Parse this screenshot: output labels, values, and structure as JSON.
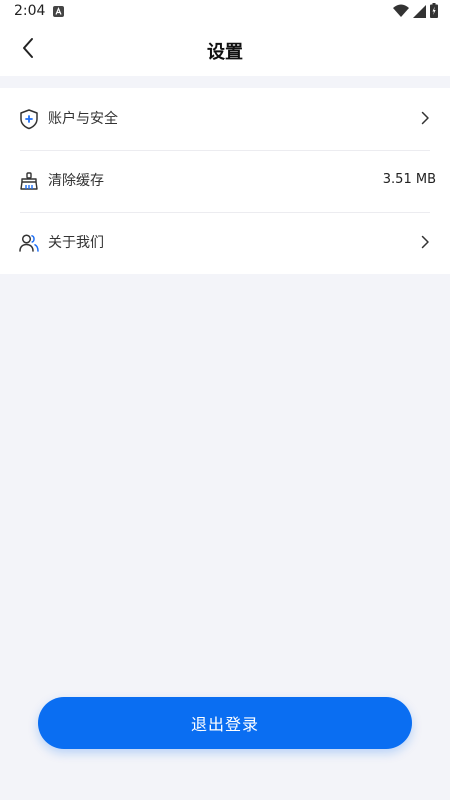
{
  "status_bar": {
    "time": "2:04",
    "icons": [
      "app-notification-icon",
      "wifi-icon",
      "signal-icon",
      "battery-charging-icon"
    ]
  },
  "header": {
    "title": "设置",
    "back_icon": "chevron-left-icon"
  },
  "menu": {
    "items": [
      {
        "label": "账户与安全",
        "icon": "shield-plus-icon",
        "trailing": "chevron-right-icon"
      },
      {
        "label": "清除缓存",
        "icon": "broom-icon",
        "value": "3.51 MB"
      },
      {
        "label": "关于我们",
        "icon": "users-icon",
        "trailing": "chevron-right-icon"
      }
    ]
  },
  "logout": {
    "label": "退出登录"
  },
  "colors": {
    "accent": "#0a6ef2",
    "background": "#f3f4f9",
    "card": "#ffffff",
    "icon_accent": "#1e6ff5",
    "icon_dark": "#333333"
  }
}
